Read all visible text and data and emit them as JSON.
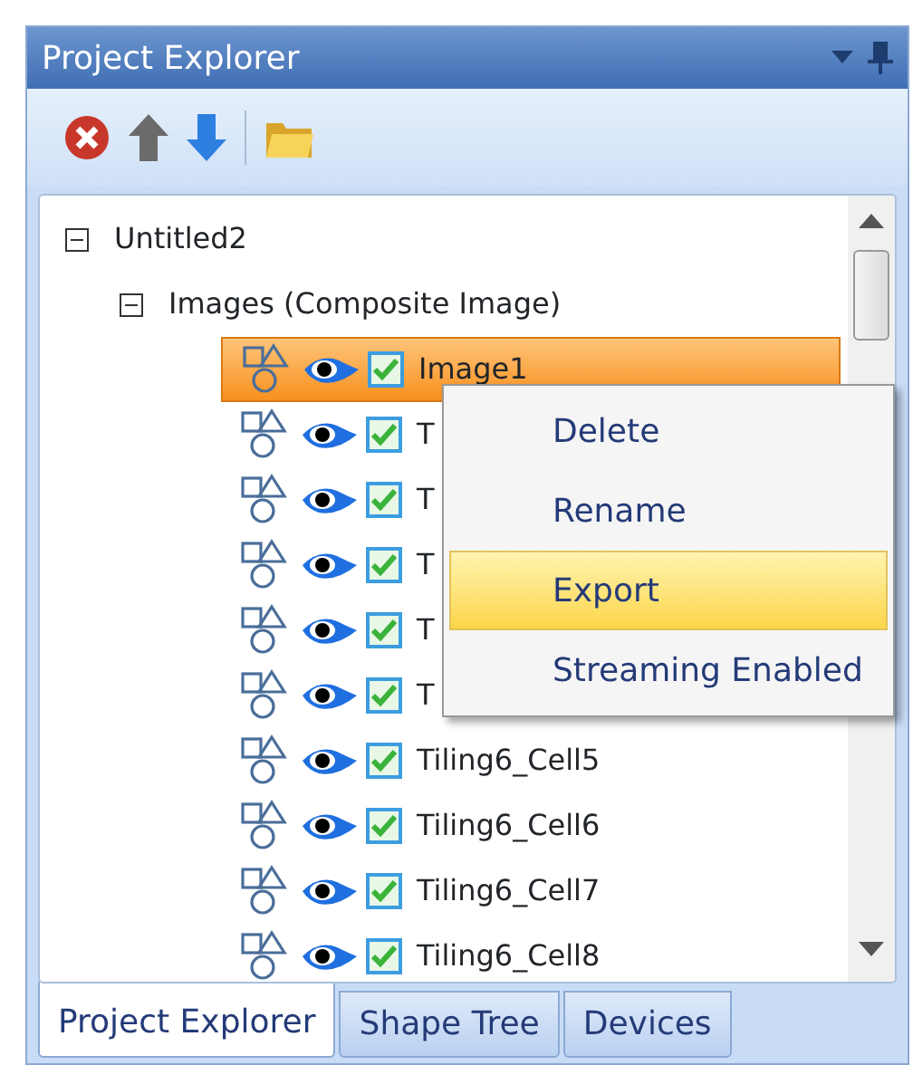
{
  "panel": {
    "title": "Project Explorer"
  },
  "toolbar": [
    {
      "kind": "delete"
    },
    {
      "kind": "up"
    },
    {
      "kind": "down"
    },
    {
      "kind": "separator"
    },
    {
      "kind": "open"
    }
  ],
  "tree": [
    {
      "label": "Untitled2",
      "expanded": true,
      "children": [
        {
          "label": "Images (Composite Image)",
          "expanded": true,
          "children": [
            {
              "label": "Image1",
              "selected": true,
              "visible": true,
              "checked": true
            },
            {
              "label": "T",
              "selected": false,
              "visible": true,
              "checked": true
            },
            {
              "label": "T",
              "selected": false,
              "visible": true,
              "checked": true
            },
            {
              "label": "T",
              "selected": false,
              "visible": true,
              "checked": true
            },
            {
              "label": "T",
              "selected": false,
              "visible": true,
              "checked": true
            },
            {
              "label": "T",
              "selected": false,
              "visible": true,
              "checked": true
            },
            {
              "label": "Tiling6_Cell5",
              "selected": false,
              "visible": true,
              "checked": true
            },
            {
              "label": "Tiling6_Cell6",
              "selected": false,
              "visible": true,
              "checked": true
            },
            {
              "label": "Tiling6_Cell7",
              "selected": false,
              "visible": true,
              "checked": true
            },
            {
              "label": "Tiling6_Cell8",
              "selected": false,
              "visible": true,
              "checked": true
            }
          ]
        }
      ]
    }
  ],
  "context_menu": [
    {
      "label": "Delete",
      "selected": false
    },
    {
      "label": "Rename",
      "selected": false
    },
    {
      "label": "Export",
      "selected": true
    },
    {
      "label": "Streaming Enabled",
      "selected": false
    }
  ],
  "tabs": [
    {
      "label": "Project Explorer",
      "selected": true
    },
    {
      "label": "Shape Tree",
      "selected": false
    },
    {
      "label": "Devices",
      "selected": false
    }
  ]
}
